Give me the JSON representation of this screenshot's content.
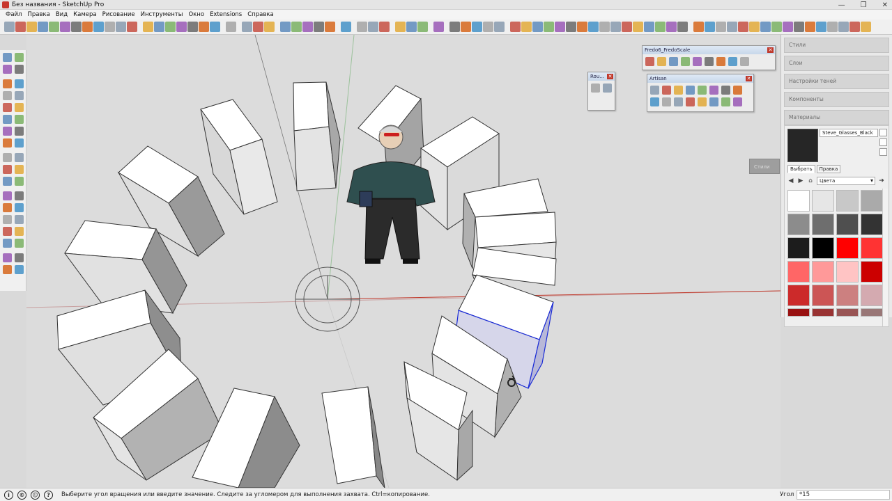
{
  "window": {
    "title": "Без названия - SketchUp Pro",
    "controls": [
      "—",
      "❐",
      "✕"
    ]
  },
  "menu": [
    "Файл",
    "Правка",
    "Вид",
    "Камера",
    "Рисование",
    "Инструменты",
    "Окно",
    "Extensions",
    "Справка"
  ],
  "colors": {
    "accent_red": "#e02020",
    "selection_blue": "#1a2bd6",
    "axis_green": "#6aa84f",
    "axis_red": "#d23030"
  },
  "panels": {
    "roundcorner": {
      "title": "Rou…",
      "close": "✕"
    },
    "fredoscale": {
      "title": "Fredo6_FredoScale",
      "close": "✕"
    },
    "artisan": {
      "title": "Artisan",
      "close": "✕"
    }
  },
  "tray": {
    "sections": [
      "Стили",
      "Слои",
      "Настройки теней",
      "Компоненты",
      "Материалы"
    ],
    "material_name": "Steve_Glasses_Black",
    "tabs": [
      "Выбрать",
      "Правка"
    ],
    "library": "Цвета",
    "ghost_label": "Стили"
  },
  "status": {
    "message": "Выберите угол вращения или введите значение. Следите за угломером для выполнения захвата. Ctrl=копирование.",
    "vcb_label": "Угол",
    "vcb_value": "*15"
  }
}
